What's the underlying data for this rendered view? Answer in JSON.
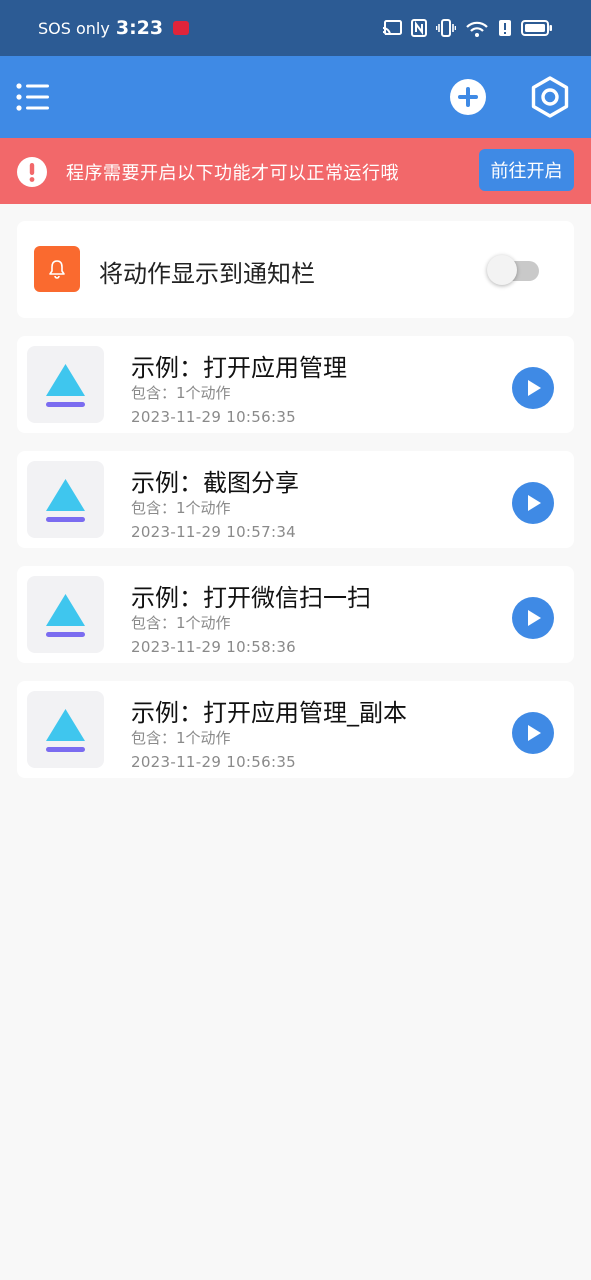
{
  "status_bar": {
    "carrier": "SOS only",
    "time": "3:23"
  },
  "app_bar": {
    "menu_icon": "menu-list-icon",
    "add_icon": "plus-circle-icon",
    "settings_icon": "hexagon-settings-icon"
  },
  "warning": {
    "text": "程序需要开启以下功能才可以正常运行哦",
    "button": "前往开启",
    "color": "#f2686a"
  },
  "notify": {
    "label": "将动作显示到通知栏",
    "toggle_on": false,
    "accent": "#fa6a2f"
  },
  "tasks": [
    {
      "title": "示例：打开应用管理",
      "subtitle": "包含：1个动作",
      "time": "2023-11-29 10:56:35"
    },
    {
      "title": "示例：截图分享",
      "subtitle": "包含：1个动作",
      "time": "2023-11-29 10:57:34"
    },
    {
      "title": "示例：打开微信扫一扫",
      "subtitle": "包含：1个动作",
      "time": "2023-11-29 10:58:36"
    },
    {
      "title": "示例：打开应用管理_副本",
      "subtitle": "包含：1个动作",
      "time": "2023-11-29 10:56:35"
    }
  ],
  "colors": {
    "primary": "#3f8ae5",
    "status_bar": "#2c5b94",
    "background": "#f8f8f8"
  }
}
